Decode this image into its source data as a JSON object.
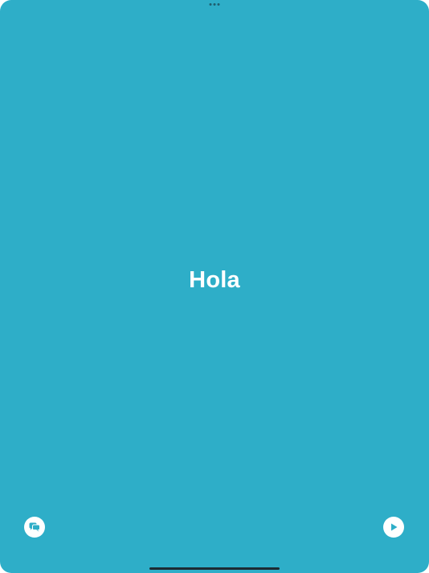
{
  "colors": {
    "background": "#2eaec8",
    "text": "#ffffff",
    "button_background": "#ffffff",
    "button_icon": "#2eaec8",
    "home_indicator": "#1b2b33"
  },
  "main": {
    "word": "Hola"
  },
  "controls": {
    "left_icon": "speech-bubbles-icon",
    "right_icon": "play-icon"
  }
}
